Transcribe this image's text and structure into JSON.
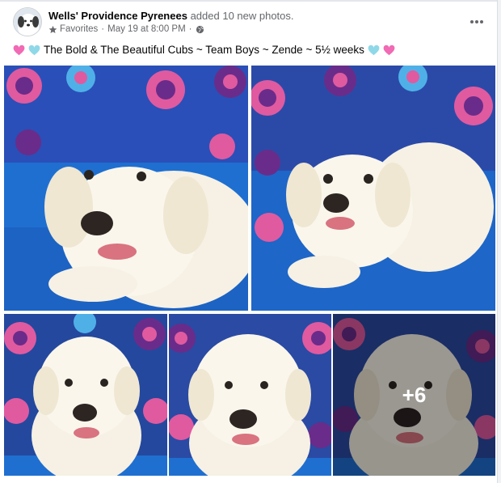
{
  "post": {
    "author_name": "Wells' Providence Pyrenees",
    "action_text": "added 10 new photos.",
    "audience": "Favorites",
    "date": "May 19 at 8:00 PM",
    "separator": "·",
    "caption": "The Bold & The Beautiful Cubs ~ Team Boys ~ Zende ~ 5½ weeks",
    "more_photos_label": "+6"
  },
  "icons": {
    "audience": "star-icon",
    "privacy": "globe-icon",
    "more": "ellipsis-icon",
    "heart_pink": "#f06ab4",
    "heart_blue": "#8fd8e8"
  },
  "colors": {
    "blanket_blue": "#1f6fd1",
    "pattern_purple": "#6a2c8a",
    "pattern_pink": "#e05aa0",
    "puppy_cream": "#f6f1e4"
  },
  "photos": [
    {
      "label": "puppy-photo-1"
    },
    {
      "label": "puppy-photo-2"
    },
    {
      "label": "puppy-photo-3"
    },
    {
      "label": "puppy-photo-4"
    },
    {
      "label": "puppy-photo-5"
    }
  ]
}
